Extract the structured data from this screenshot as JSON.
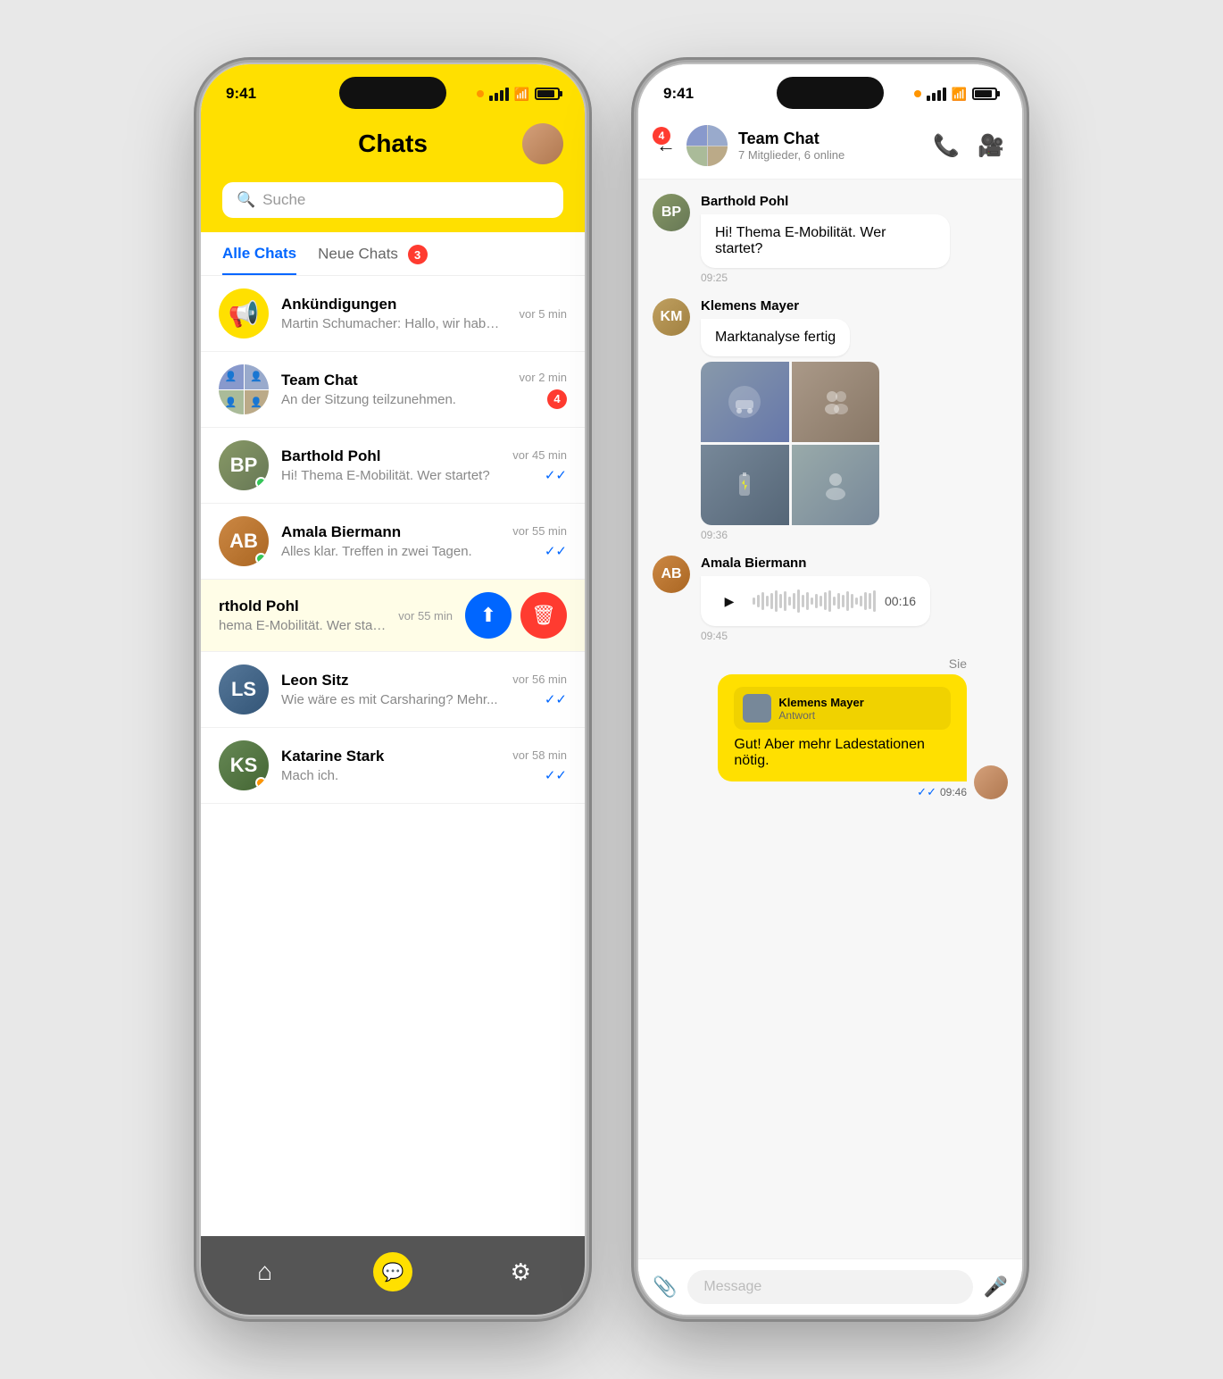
{
  "phone1": {
    "statusBar": {
      "time": "9:41",
      "orangeDot": true
    },
    "header": {
      "title": "Chats"
    },
    "search": {
      "placeholder": "Suche"
    },
    "tabs": [
      {
        "label": "Alle Chats",
        "active": true,
        "badge": null
      },
      {
        "label": "Neue Chats",
        "active": false,
        "badge": "3"
      }
    ],
    "chatList": [
      {
        "id": "announcements",
        "name": "Ankündigungen",
        "preview": "Martin Schumacher: Hallo, wir haben Neui...",
        "time": "vor 5 min",
        "type": "channel",
        "unread": null,
        "avatarType": "yellow-icon"
      },
      {
        "id": "team-chat",
        "name": "Team Chat",
        "preview": "An der Sitzung teilzunehmen.",
        "time": "vor 2 min",
        "type": "group",
        "unread": "4",
        "avatarType": "group"
      },
      {
        "id": "barthold",
        "name": "Barthold Pohl",
        "preview": "Hi! Thema E-Mobilität. Wer startet?",
        "time": "vor 45 min",
        "type": "person",
        "unread": null,
        "check": true,
        "online": true
      },
      {
        "id": "amala",
        "name": "Amala Biermann",
        "preview": "Alles klar. Treffen in zwei Tagen.",
        "time": "vor 55 min",
        "type": "person",
        "unread": null,
        "check": true,
        "online": true
      },
      {
        "id": "barthold2",
        "name": "rthold Pohl",
        "preview": "hema E-Mobilität. Wer startet?",
        "time": "vor 55 min",
        "type": "person-swipe",
        "unread": null,
        "highlighted": true
      },
      {
        "id": "leon",
        "name": "Leon Sitz",
        "preview": "Wie wäre es mit Carsharing? Mehr...",
        "time": "vor 56 min",
        "type": "person",
        "unread": null,
        "check": true
      },
      {
        "id": "katarine",
        "name": "Katarine Stark",
        "preview": "Mach ich.",
        "time": "vor 58 min",
        "type": "person",
        "unread": null,
        "check": true,
        "online": false,
        "dotColor": "orange"
      }
    ],
    "bottomNav": {
      "items": [
        "home",
        "chat",
        "settings"
      ]
    }
  },
  "phone2": {
    "statusBar": {
      "time": "9:41",
      "orangeDot": true
    },
    "header": {
      "title": "Team Chat",
      "subtitle": "7 Mitglieder, 6 online",
      "backBadge": "4"
    },
    "messages": [
      {
        "id": "msg1",
        "sender": "Barthold Pohl",
        "avatarColor": "av-barthold",
        "initials": "BP",
        "text": "Hi! Thema E-Mobilität. Wer startet?",
        "time": "09:25",
        "type": "text"
      },
      {
        "id": "msg2",
        "sender": "Klemens Mayer",
        "avatarColor": "av-klemens",
        "initials": "KM",
        "text": "Marktanalyse fertig",
        "time": "09:36",
        "type": "text-images",
        "images": [
          "car",
          "people",
          "charger",
          "team"
        ]
      },
      {
        "id": "msg3",
        "sender": "Amala Biermann",
        "avatarColor": "av-amala",
        "initials": "AB",
        "time": "09:45",
        "type": "voice",
        "duration": "00:16"
      },
      {
        "id": "msg4",
        "sender": "Sie",
        "type": "own",
        "replyTo": {
          "name": "Klemens Mayer",
          "label": "Antwort"
        },
        "text": "Gut! Aber mehr Ladestationen nötig.",
        "time": "09:46",
        "check": true
      }
    ],
    "input": {
      "placeholder": "Message"
    }
  }
}
